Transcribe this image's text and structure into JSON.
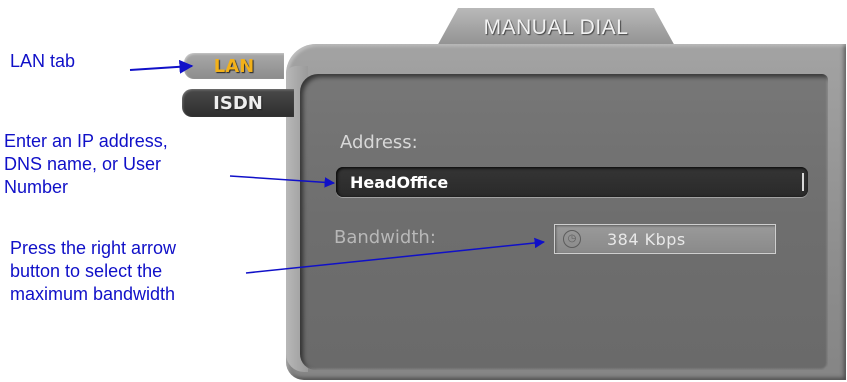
{
  "window": {
    "title": "MANUAL DIAL"
  },
  "tabs": [
    {
      "label": "LAN",
      "active": true
    },
    {
      "label": "ISDN",
      "active": false
    }
  ],
  "form": {
    "address_label": "Address:",
    "address_value": "HeadOffice",
    "bandwidth_label": "Bandwidth:",
    "bandwidth_value": "384 Kbps"
  },
  "annotations": {
    "lan_tab": "LAN tab",
    "address_line1": "Enter an IP address,",
    "address_line2": "DNS name, or User",
    "address_line3": "Number",
    "bandwidth_line1": "Press the right arrow",
    "bandwidth_line2": "button to select the",
    "bandwidth_line3": "maximum bandwidth"
  },
  "colors": {
    "annotation_text": "#1010c8",
    "active_tab_text": "#f2b11a",
    "panel": "#8f8f8f"
  },
  "icons": {
    "bandwidth_selector": "clock-icon"
  }
}
